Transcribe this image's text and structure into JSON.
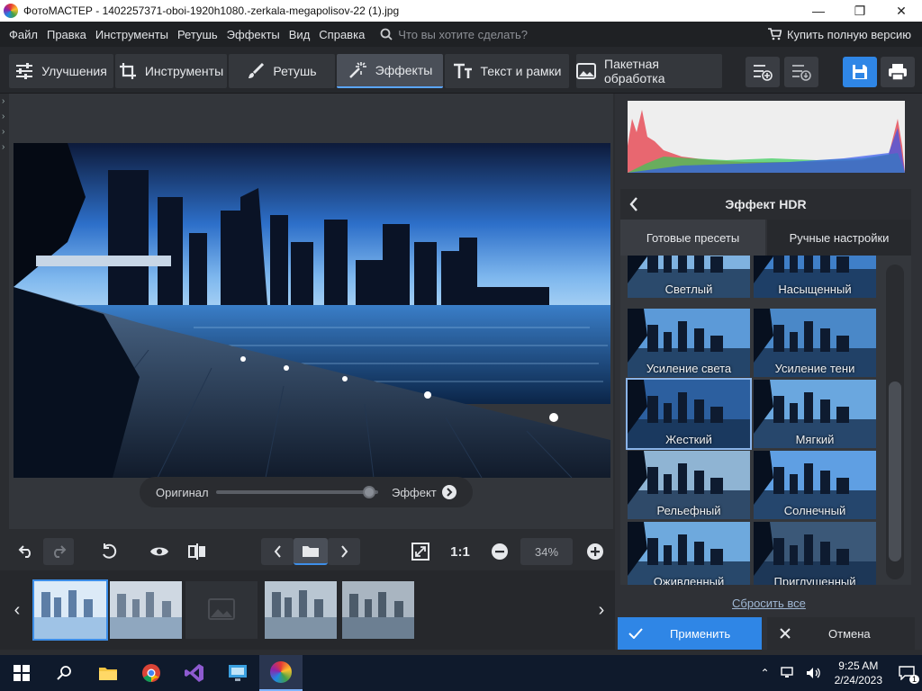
{
  "window": {
    "title": "ФотоМАСТЕР - 1402257371-oboi-1920h1080.-zerkala-megapolisov-22 (1).jpg",
    "minimize": "—",
    "maximize": "❐",
    "close": "✕"
  },
  "menu": {
    "items": [
      "Файл",
      "Правка",
      "Инструменты",
      "Ретушь",
      "Эффекты",
      "Вид",
      "Справка"
    ],
    "search_placeholder": "Что вы хотите сделать?",
    "buy": "Купить полную версию"
  },
  "tabs": [
    {
      "label": "Улучшения",
      "icon": "sliders-icon"
    },
    {
      "label": "Инструменты",
      "icon": "crop-icon"
    },
    {
      "label": "Ретушь",
      "icon": "brush-icon"
    },
    {
      "label": "Эффекты",
      "icon": "magic-wand-icon"
    },
    {
      "label": "Текст и рамки",
      "icon": "text-icon"
    },
    {
      "label": "Пакетная обработка",
      "icon": "image-icon"
    }
  ],
  "compare": {
    "left": "Оригинал",
    "right": "Эффект"
  },
  "view": {
    "ratio": "1:1",
    "zoom": "34%"
  },
  "panel": {
    "title": "Эффект HDR",
    "tab_presets": "Готовые пресеты",
    "tab_manual": "Ручные настройки",
    "presets": [
      "Светлый",
      "Насыщенный",
      "Усиление света",
      "Усиление тени",
      "Жесткий",
      "Мягкий",
      "Рельефный",
      "Солнечный",
      "Оживленный",
      "Приглушенный"
    ],
    "selected": "Жесткий",
    "reset": "Сбросить все",
    "apply": "Применить",
    "cancel": "Отмена"
  },
  "taskbar": {
    "time": "9:25 AM",
    "date": "2/24/2023",
    "notifications": "1"
  },
  "colors": {
    "accent": "#2f86e6",
    "panel": "#2f3136",
    "toolbar": "#26282c"
  }
}
